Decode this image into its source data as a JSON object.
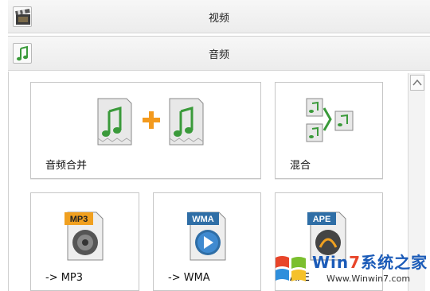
{
  "sections": {
    "video": {
      "label": "视频",
      "icon": "film-clapper-icon"
    },
    "audio": {
      "label": "音频",
      "icon": "music-note-icon"
    }
  },
  "tiles": [
    {
      "id": "audio-merge",
      "label": "音频合并",
      "icon": "audio-merge-icon"
    },
    {
      "id": "mix",
      "label": "混合",
      "icon": "audio-mix-icon"
    },
    {
      "id": "to-mp3",
      "label": "-> MP3",
      "icon": "mp3-file-icon",
      "badge": "MP3"
    },
    {
      "id": "to-wma",
      "label": "-> WMA",
      "icon": "wma-file-icon",
      "badge": "WMA"
    },
    {
      "id": "to-ape",
      "label": "APE",
      "icon": "ape-file-icon",
      "badge": "APE"
    }
  ],
  "watermark": {
    "title_win": "Win",
    "title_7": "7",
    "title_rest": "系统之家",
    "url": "Www.Winwin7.com"
  },
  "colors": {
    "note_green": "#3a9a3a",
    "plus_orange": "#f39a1e",
    "badge_orange": "#f0a020",
    "badge_blue": "#2f6ea6",
    "watermark_blue": "#1b5bb8"
  }
}
